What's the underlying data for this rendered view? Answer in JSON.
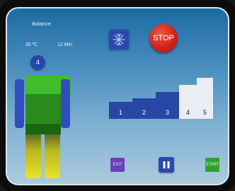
{
  "header": {
    "program": "Balance",
    "temperature": "35 ºC",
    "duration": "12 Min"
  },
  "body_figure": {
    "zone_number": "4",
    "colors": {
      "head": "#2846a8",
      "arms": "#2f4fbd",
      "shoulders": "#3fbd2a",
      "torso": "#2a8a1e",
      "hips": "#19660f",
      "legs": "#e8e32a"
    }
  },
  "controls": {
    "cooling_icon": "snowflake-icon",
    "stop_label": "STOP",
    "exit_label": "EXIT",
    "pause_icon": "pause-icon",
    "start_label": "START"
  },
  "intensity": {
    "levels": [
      "1",
      "2",
      "3",
      "4",
      "5"
    ],
    "active_level": 3,
    "active_color": "#2847a5",
    "inactive_color": "#e9eef2"
  }
}
